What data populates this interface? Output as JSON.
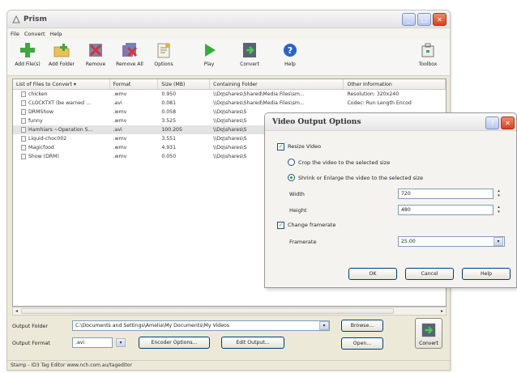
{
  "app": {
    "title": "Prism",
    "menu": [
      "File",
      "Convert",
      "Help"
    ]
  },
  "toolbar": {
    "add_files": "Add File(s)",
    "add_folder": "Add Folder",
    "remove": "Remove",
    "remove_all": "Remove All",
    "options": "Options",
    "play": "Play",
    "convert": "Convert",
    "help": "Help",
    "toolbox": "Toolbox"
  },
  "table": {
    "columns": [
      "List of Files to Convert",
      "Format",
      "Size (MB)",
      "Containing Folder",
      "Other Information"
    ],
    "sort_indicator": "▾",
    "rows": [
      {
        "name": "chicken",
        "format": ".wmv",
        "size": "0.950",
        "folder": "\\\\Dq\\shares\\Shared\\Media Files\\sm...",
        "info": "Resolution: 320x240"
      },
      {
        "name": "CLOCKTXT (be warned ...",
        "format": ".avi",
        "size": "0.081",
        "folder": "\\\\Dq\\shares\\Shared\\Media Files\\sm...",
        "info": "Codec: Run Length Encod"
      },
      {
        "name": "DRMShow",
        "format": ".wmv",
        "size": "0.058",
        "folder": "\\\\Dq\\shares\\S",
        "info": ""
      },
      {
        "name": "funny",
        "format": ".wmv",
        "size": "3.525",
        "folder": "\\\\Dq\\shares\\S",
        "info": ""
      },
      {
        "name": "Hamhiars ~Operation S...",
        "format": ".avi",
        "size": "100.205",
        "folder": "\\\\Dq\\shares\\S",
        "info": ""
      },
      {
        "name": "Liquid-choc002",
        "format": ".wmv",
        "size": "3.551",
        "folder": "\\\\Dq\\shares\\S",
        "info": ""
      },
      {
        "name": "Magicfood",
        "format": ".wmv",
        "size": "4.931",
        "folder": "\\\\Dq\\shares\\S",
        "info": ""
      },
      {
        "name": "Show (DRM)",
        "format": ".wmv",
        "size": "0.050",
        "folder": "\\\\Dq\\shares\\S",
        "info": ""
      }
    ]
  },
  "bottom": {
    "output_folder_label": "Output Folder",
    "output_folder_value": "C:\\Documents and Settings\\Amelia\\My Documents\\My Videos",
    "browse": "Browse...",
    "output_format_label": "Output Format",
    "output_format_value": ".avi",
    "encoder_options": "Encoder Options...",
    "edit_output": "Edit Output...",
    "open": "Open...",
    "convert": "Convert",
    "status": "Stamp - ID3 Tag Editor www.nch.com.au/tageditor"
  },
  "dialog": {
    "title": "Video Output Options",
    "resize_video": "Resize Video",
    "crop_option": "Crop the video to the selected size",
    "shrink_option": "Shrink or Enlarge the video to the selected size",
    "width_label": "Width",
    "width_value": "720",
    "height_label": "Height",
    "height_value": "480",
    "change_framerate": "Change framerate",
    "framerate_label": "Framerate",
    "framerate_value": "25.00",
    "ok": "OK",
    "cancel": "Cancel",
    "help": "Help"
  },
  "colors": {
    "selected_row": "#e3e3e3",
    "close_button": "#d4421c",
    "check_green": "#21a121",
    "window_bg": "#ece9d8"
  }
}
